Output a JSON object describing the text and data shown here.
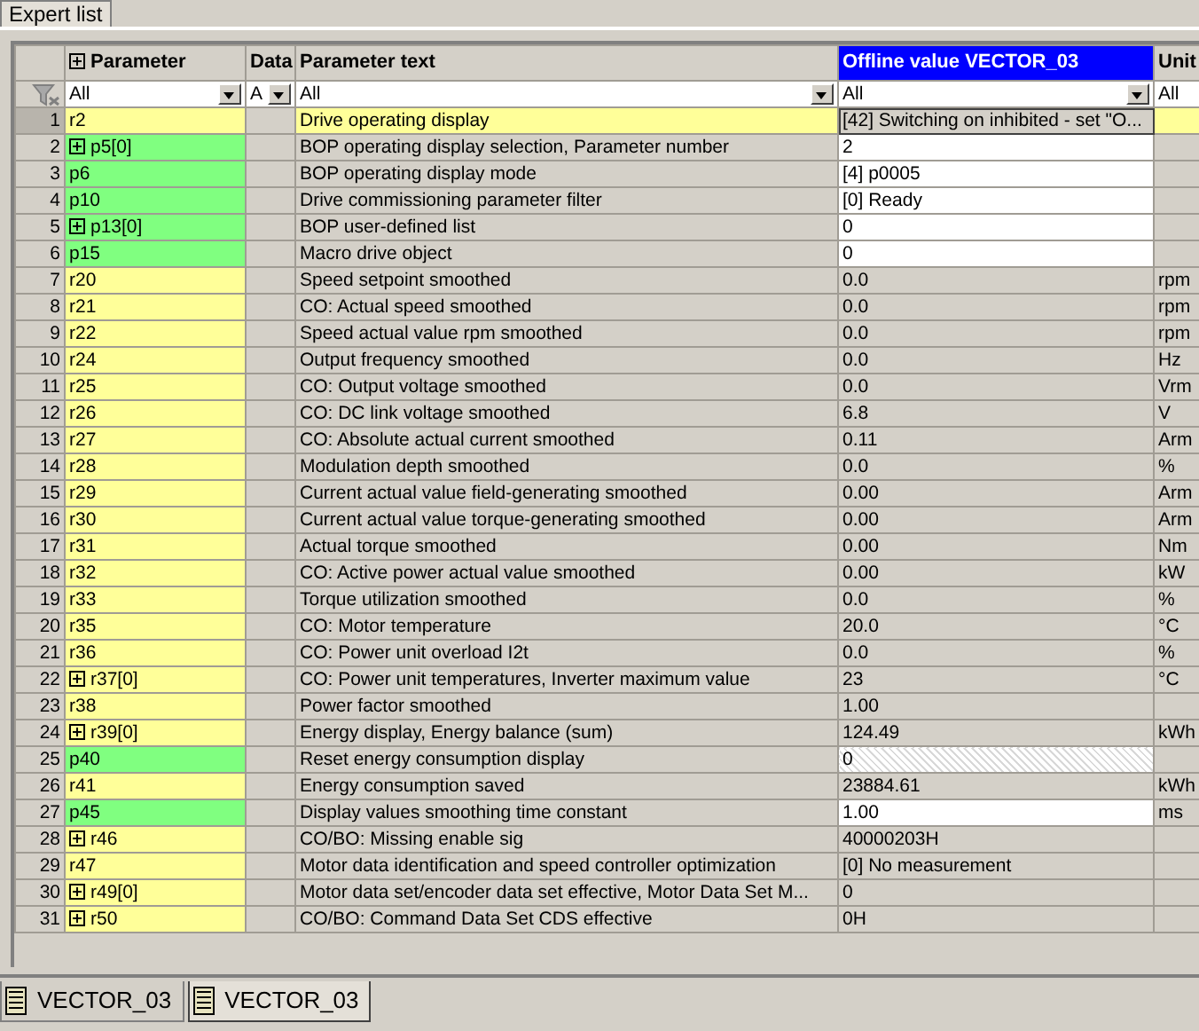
{
  "top_tabs": [
    {
      "label": "Expert list",
      "selected": true
    }
  ],
  "columns": [
    {
      "label": "Parameter",
      "expandable": true,
      "highlighted": false
    },
    {
      "label": "Data",
      "expandable": false,
      "highlighted": false
    },
    {
      "label": "Parameter text",
      "expandable": false,
      "highlighted": false
    },
    {
      "label": "Offline value VECTOR_03",
      "expandable": false,
      "highlighted": true
    },
    {
      "label": "Unit",
      "expandable": false,
      "highlighted": false
    }
  ],
  "filters": [
    {
      "value": "All",
      "dropdown": true
    },
    {
      "value": "A",
      "dropdown": true
    },
    {
      "value": "All",
      "dropdown": true
    },
    {
      "value": "All",
      "dropdown": true
    },
    {
      "value": "All",
      "dropdown": false
    }
  ],
  "rows": [
    {
      "no": "1",
      "param": "r2",
      "writable": false,
      "expandable": false,
      "text": "Drive operating display",
      "value": "[42] Switching on inhibited - set \"O...",
      "value_editable": false,
      "value_locked": false,
      "selected": true
    },
    {
      "no": "2",
      "param": "p5[0]",
      "writable": true,
      "expandable": true,
      "text": "BOP operating display selection, Parameter number",
      "value": "2",
      "value_editable": true,
      "value_locked": false,
      "selected": false
    },
    {
      "no": "3",
      "param": "p6",
      "writable": true,
      "expandable": false,
      "text": "BOP operating display mode",
      "value": "[4] p0005",
      "value_editable": true,
      "value_locked": false,
      "selected": false
    },
    {
      "no": "4",
      "param": "p10",
      "writable": true,
      "expandable": false,
      "text": "Drive commissioning parameter filter",
      "value": "[0] Ready",
      "value_editable": true,
      "value_locked": false,
      "selected": false
    },
    {
      "no": "5",
      "param": "p13[0]",
      "writable": true,
      "expandable": true,
      "text": "BOP user-defined list",
      "value": "0",
      "value_editable": true,
      "value_locked": false,
      "selected": false
    },
    {
      "no": "6",
      "param": "p15",
      "writable": true,
      "expandable": false,
      "text": "Macro drive object",
      "value": "0",
      "value_editable": true,
      "value_locked": false,
      "selected": false
    },
    {
      "no": "7",
      "param": "r20",
      "writable": false,
      "expandable": false,
      "text": "Speed setpoint smoothed",
      "value": "0.0",
      "value_editable": false,
      "value_locked": false,
      "unit": "rpm",
      "selected": false
    },
    {
      "no": "8",
      "param": "r21",
      "writable": false,
      "expandable": false,
      "text": "CO: Actual speed smoothed",
      "value": "0.0",
      "value_editable": false,
      "value_locked": false,
      "unit": "rpm",
      "selected": false
    },
    {
      "no": "9",
      "param": "r22",
      "writable": false,
      "expandable": false,
      "text": "Speed actual value rpm smoothed",
      "value": "0.0",
      "value_editable": false,
      "value_locked": false,
      "unit": "rpm",
      "selected": false
    },
    {
      "no": "10",
      "param": "r24",
      "writable": false,
      "expandable": false,
      "text": "Output frequency smoothed",
      "value": "0.0",
      "value_editable": false,
      "value_locked": false,
      "unit": "Hz",
      "selected": false
    },
    {
      "no": "11",
      "param": "r25",
      "writable": false,
      "expandable": false,
      "text": "CO: Output voltage smoothed",
      "value": "0.0",
      "value_editable": false,
      "value_locked": false,
      "unit": "Vrm",
      "selected": false
    },
    {
      "no": "12",
      "param": "r26",
      "writable": false,
      "expandable": false,
      "text": "CO: DC link voltage smoothed",
      "value": "6.8",
      "value_editable": false,
      "value_locked": false,
      "unit": "V",
      "selected": false
    },
    {
      "no": "13",
      "param": "r27",
      "writable": false,
      "expandable": false,
      "text": "CO: Absolute actual current smoothed",
      "value": "0.11",
      "value_editable": false,
      "value_locked": false,
      "unit": "Arm",
      "selected": false
    },
    {
      "no": "14",
      "param": "r28",
      "writable": false,
      "expandable": false,
      "text": "Modulation depth smoothed",
      "value": "0.0",
      "value_editable": false,
      "value_locked": false,
      "unit": "%",
      "selected": false
    },
    {
      "no": "15",
      "param": "r29",
      "writable": false,
      "expandable": false,
      "text": "Current actual value field-generating smoothed",
      "value": "0.00",
      "value_editable": false,
      "value_locked": false,
      "unit": "Arm",
      "selected": false
    },
    {
      "no": "16",
      "param": "r30",
      "writable": false,
      "expandable": false,
      "text": "Current actual value torque-generating smoothed",
      "value": "0.00",
      "value_editable": false,
      "value_locked": false,
      "unit": "Arm",
      "selected": false
    },
    {
      "no": "17",
      "param": "r31",
      "writable": false,
      "expandable": false,
      "text": "Actual torque smoothed",
      "value": "0.00",
      "value_editable": false,
      "value_locked": false,
      "unit": "Nm",
      "selected": false
    },
    {
      "no": "18",
      "param": "r32",
      "writable": false,
      "expandable": false,
      "text": "CO: Active power actual value smoothed",
      "value": "0.00",
      "value_editable": false,
      "value_locked": false,
      "unit": "kW",
      "selected": false
    },
    {
      "no": "19",
      "param": "r33",
      "writable": false,
      "expandable": false,
      "text": "Torque utilization smoothed",
      "value": "0.0",
      "value_editable": false,
      "value_locked": false,
      "unit": "%",
      "selected": false
    },
    {
      "no": "20",
      "param": "r35",
      "writable": false,
      "expandable": false,
      "text": "CO: Motor temperature",
      "value": "20.0",
      "value_editable": false,
      "value_locked": false,
      "unit": "°C",
      "selected": false
    },
    {
      "no": "21",
      "param": "r36",
      "writable": false,
      "expandable": false,
      "text": "CO: Power unit overload I2t",
      "value": "0.0",
      "value_editable": false,
      "value_locked": false,
      "unit": "%",
      "selected": false
    },
    {
      "no": "22",
      "param": "r37[0]",
      "writable": false,
      "expandable": true,
      "text": "CO: Power unit temperatures, Inverter maximum value",
      "value": "23",
      "value_editable": false,
      "value_locked": false,
      "unit": "°C",
      "selected": false
    },
    {
      "no": "23",
      "param": "r38",
      "writable": false,
      "expandable": false,
      "text": "Power factor smoothed",
      "value": "1.00",
      "value_editable": false,
      "value_locked": false,
      "selected": false
    },
    {
      "no": "24",
      "param": "r39[0]",
      "writable": false,
      "expandable": true,
      "text": "Energy display, Energy balance (sum)",
      "value": "124.49",
      "value_editable": false,
      "value_locked": false,
      "unit": "kWh",
      "selected": false
    },
    {
      "no": "25",
      "param": "p40",
      "writable": true,
      "expandable": false,
      "text": "Reset energy consumption display",
      "value": "0",
      "value_editable": false,
      "value_locked": true,
      "selected": false
    },
    {
      "no": "26",
      "param": "r41",
      "writable": false,
      "expandable": false,
      "text": "Energy consumption saved",
      "value": "23884.61",
      "value_editable": false,
      "value_locked": false,
      "unit": "kWh",
      "selected": false
    },
    {
      "no": "27",
      "param": "p45",
      "writable": true,
      "expandable": false,
      "text": "Display values smoothing time constant",
      "value": "1.00",
      "value_editable": true,
      "value_locked": false,
      "unit": "ms",
      "selected": false
    },
    {
      "no": "28",
      "param": "r46",
      "writable": false,
      "expandable": true,
      "text": "CO/BO: Missing enable sig",
      "value": "40000203H",
      "value_editable": false,
      "value_locked": false,
      "selected": false
    },
    {
      "no": "29",
      "param": "r47",
      "writable": false,
      "expandable": false,
      "text": "Motor data identification and speed controller optimization",
      "value": "[0] No measurement",
      "value_editable": false,
      "value_locked": false,
      "selected": false
    },
    {
      "no": "30",
      "param": "r49[0]",
      "writable": false,
      "expandable": true,
      "text": "Motor data set/encoder data set effective, Motor Data Set M...",
      "value": "0",
      "value_editable": false,
      "value_locked": false,
      "selected": false
    },
    {
      "no": "31",
      "param": "r50",
      "writable": false,
      "expandable": true,
      "text": "CO/BO: Command Data Set CDS effective",
      "value": "0H",
      "value_editable": false,
      "value_locked": false,
      "selected": false
    }
  ],
  "bottom_tabs": [
    {
      "label": "VECTOR_03",
      "selected": false
    },
    {
      "label": "VECTOR_03",
      "selected": true
    }
  ]
}
